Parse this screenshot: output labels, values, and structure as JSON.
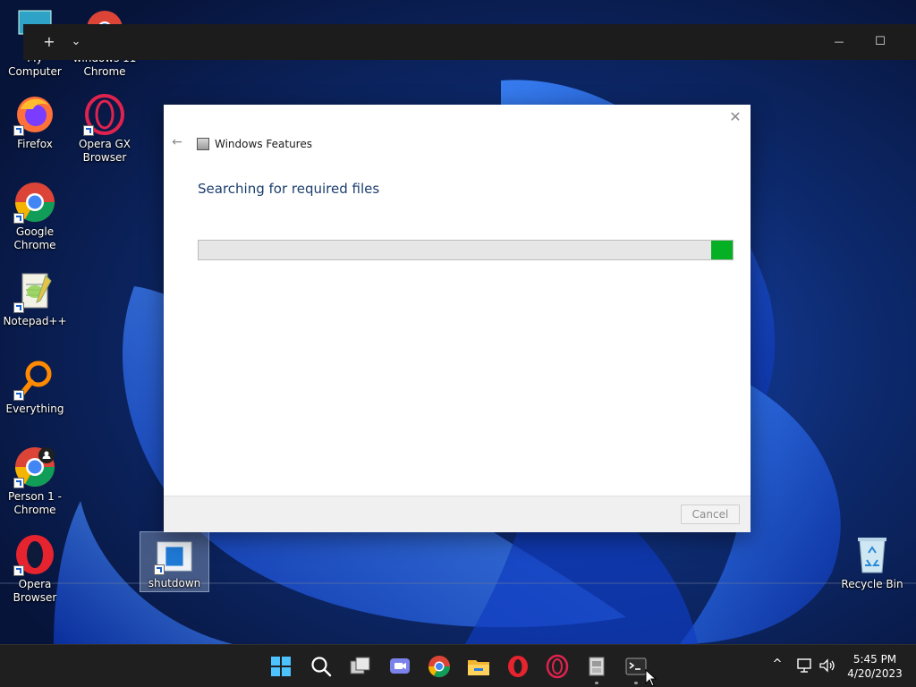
{
  "desktop": {
    "icons": [
      {
        "label": "My Computer"
      },
      {
        "label": "windows 11 Chrome"
      },
      {
        "label": "Firefox"
      },
      {
        "label": "Opera GX Browser"
      },
      {
        "label": "Google Chrome"
      },
      {
        "label": "Notepad++"
      },
      {
        "label": "Everything"
      },
      {
        "label": "Person 1 - Chrome"
      },
      {
        "label": "Opera Browser"
      },
      {
        "label": "shutdown"
      },
      {
        "label": "Recycle Bin"
      }
    ]
  },
  "terminal": {
    "new_tab": "+",
    "dropdown": "⌄",
    "minimize": "—",
    "maximize": "☐"
  },
  "dialog": {
    "title": "Windows Features",
    "heading": "Searching for required files",
    "progress": 0.96,
    "cancel_label": "Cancel",
    "close": "✕",
    "back": "←"
  },
  "taskbar": {
    "apps": [
      "start-icon",
      "search-icon",
      "task-view-icon",
      "chat-icon",
      "chrome-icon",
      "file-explorer-icon",
      "opera-icon",
      "opera-gx-icon",
      "windows-features-icon",
      "terminal-icon"
    ],
    "tray_up": "^",
    "clock_time": "5:45 PM",
    "clock_date": "4/20/2023"
  },
  "colors": {
    "accent": "#0067c0",
    "progress": "#06b025",
    "heading": "#1c3e6e",
    "taskbar": "#1f1f1f"
  }
}
